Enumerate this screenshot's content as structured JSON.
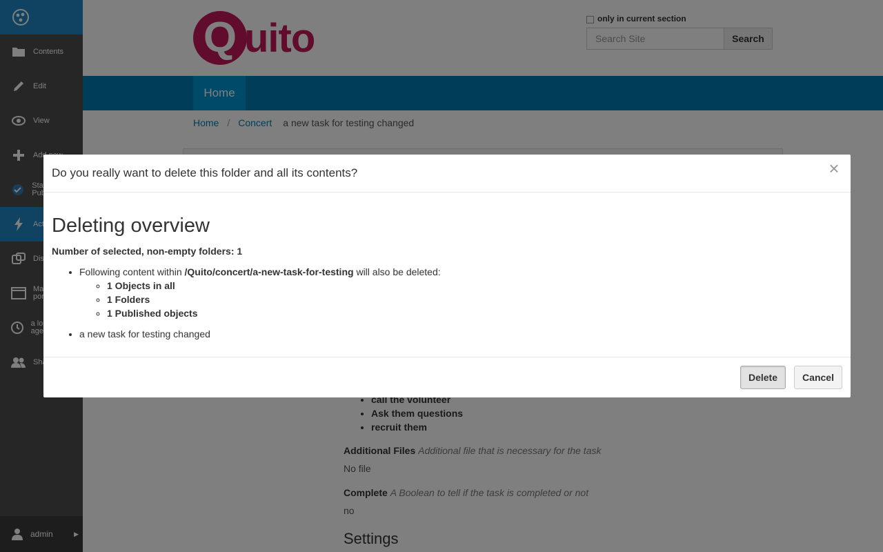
{
  "toolbar": {
    "items": [
      {
        "label": "Contents",
        "icon": "folder-icon"
      },
      {
        "label": "Edit",
        "icon": "pencil-icon"
      },
      {
        "label": "View",
        "icon": "eye-icon"
      },
      {
        "label": "Add new",
        "icon": "plus-icon"
      },
      {
        "label": "State: Published",
        "icon": "state-icon"
      },
      {
        "label": "Actions",
        "icon": "bolt-icon"
      },
      {
        "label": "Display",
        "icon": "display-icon"
      },
      {
        "label": "Manage portlets",
        "icon": "portlets-icon"
      },
      {
        "label": "a long section age",
        "icon": "history-icon"
      },
      {
        "label": "Sharing",
        "icon": "users-icon"
      }
    ],
    "user": "admin"
  },
  "header": {
    "logo_first": "Q",
    "logo_rest": "uito",
    "only_current_section": "only in current section",
    "search_placeholder": "Search Site",
    "search_button": "Search"
  },
  "nav": {
    "home": "Home"
  },
  "breadcrumb": {
    "home": "Home",
    "concert": "Concert",
    "current": "a new task for testing changed"
  },
  "behind": {
    "steps": [
      "call the volunteer",
      "Ask them questions",
      "recruit them"
    ],
    "additional_files_label": "Additional Files",
    "additional_files_desc": "Additional file that is necessary for the task",
    "additional_files_value": "No file",
    "complete_label": "Complete",
    "complete_desc": "A Boolean to tell if the task is completed or not",
    "complete_value": "no",
    "settings": "Settings"
  },
  "modal": {
    "title": "Do you really want to delete this folder and all its contents?",
    "heading": "Deleting overview",
    "count_line": "Number of selected, non-empty folders: 1",
    "following_prefix": "Following content within ",
    "following_path": "/Quito/concert/a-new-task-for-testing",
    "following_suffix": " will also be deleted:",
    "stats": [
      "1 Objects in all",
      "1 Folders",
      "1 Published objects"
    ],
    "item": "a new task for testing changed",
    "delete_button": "Delete",
    "cancel_button": "Cancel"
  }
}
